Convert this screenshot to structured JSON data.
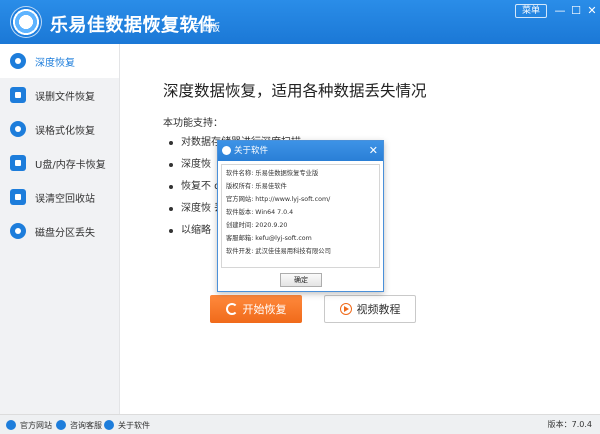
{
  "titlebar": {
    "app_name": "乐易佳数据恢复软件",
    "edition": "专业版",
    "menu_label": "菜单",
    "minimize_glyph": "—",
    "maximize_glyph": "☐",
    "close_glyph": "✕"
  },
  "sidebar": {
    "items": [
      {
        "label": "深度恢复",
        "icon": "deep-recovery-icon"
      },
      {
        "label": "误删文件恢复",
        "icon": "deleted-file-icon"
      },
      {
        "label": "误格式化恢复",
        "icon": "format-icon"
      },
      {
        "label": "U盘/内存卡恢复",
        "icon": "usb-icon"
      },
      {
        "label": "误清空回收站",
        "icon": "recycle-bin-icon"
      },
      {
        "label": "磁盘分区丢失",
        "icon": "partition-icon"
      }
    ]
  },
  "main": {
    "headline": "深度数据恢复，适用各种数据丢失情况",
    "feature_title": "本功能支持：",
    "features": [
      "对数据存储器进行深度扫描",
      "深度恢",
      "恢复不                                              dows分区)",
      "深度恢                                              丢失",
      "以缩略"
    ],
    "start_button": "开始恢复",
    "video_button": "视频教程"
  },
  "dialog": {
    "title": "关于软件",
    "close_glyph": "✕",
    "rows": [
      "软件名称: 乐易佳数据恢复专业版",
      "版权所有: 乐易佳软件",
      "官方网站: http://www.lyj-soft.com/",
      "软件版本: Win64 7.0.4",
      "创建时间: 2020.9.20",
      "客服邮箱: kefu@lyj-soft.com",
      "软件开发: 武汉佳佳易用科技有限公司"
    ],
    "ok_label": "确定"
  },
  "statusbar": {
    "official_site": "官方网站",
    "support": "咨询客服",
    "about": "关于软件",
    "version": "版本：7.0.4"
  },
  "colors": {
    "accent": "#1d7ddb",
    "start_button": "#f06a1a"
  }
}
